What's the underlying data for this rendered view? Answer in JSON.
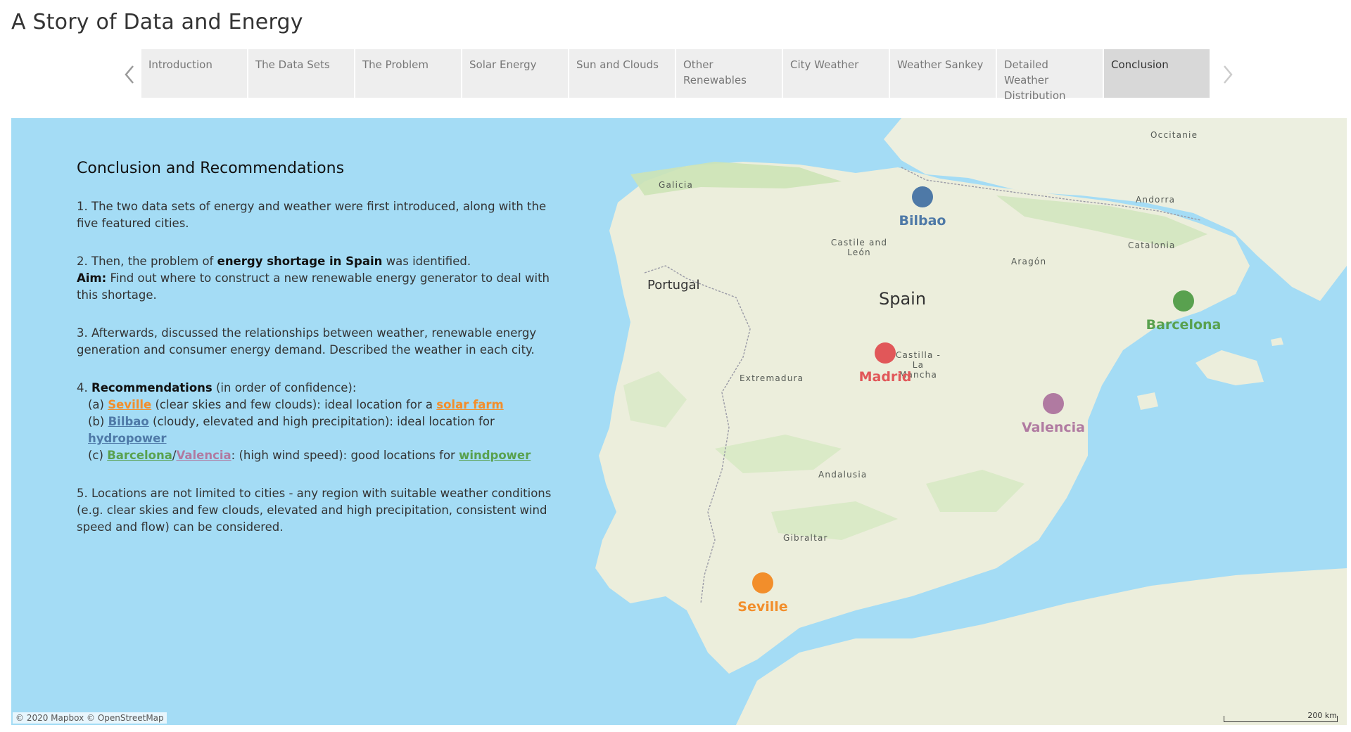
{
  "app": {
    "title": "A Story of Data and Energy"
  },
  "nav": {
    "tabs": [
      {
        "label": "Introduction"
      },
      {
        "label": "The Data Sets"
      },
      {
        "label": "The Problem"
      },
      {
        "label": "Solar Energy"
      },
      {
        "label": "Sun and Clouds"
      },
      {
        "label": "Other Renewables"
      },
      {
        "label": "City Weather"
      },
      {
        "label": "Weather Sankey"
      },
      {
        "label": "Detailed Weather Distribution"
      },
      {
        "label": "Conclusion",
        "active": true
      }
    ],
    "prev_icon": "chevron-left-icon",
    "next_icon": "chevron-right-icon"
  },
  "colors": {
    "seville": "#f28e2b",
    "bilbao": "#4e79a7",
    "barcelona": "#59a14f",
    "valencia": "#b07aa1",
    "madrid": "#e15759"
  },
  "conclusion": {
    "heading": "Conclusion and Recommendations",
    "p1": "1. The two data sets of energy and weather were first introduced, along with the five featured cities.",
    "p2_a": "2. Then, the problem of ",
    "p2_bold": "energy shortage in Spain",
    "p2_b": " was identified.",
    "aim_label": "Aim:",
    "aim_text": " Find out where to construct a new renewable energy generator to deal with this shortage.",
    "p3": "3. Afterwards, discussed the relationships between weather, renewable energy generation and consumer energy demand. Described the weather in each city.",
    "p4_a": "4. ",
    "p4_bold": "Recommendations",
    "p4_b": " (in order of confidence):",
    "rec_a_prefix": "(a)  ",
    "rec_a_city": "Seville",
    "rec_a_text": " (clear skies and few clouds): ideal location for a ",
    "rec_a_target": "solar farm",
    "rec_b_prefix": "(b)  ",
    "rec_b_city": "Bilbao",
    "rec_b_text": " (cloudy, elevated and high precipitation): ideal location for ",
    "rec_b_target": "hydropower",
    "rec_c_prefix": "(c)  ",
    "rec_c_city1": "Barcelona",
    "rec_c_sep": "/",
    "rec_c_city2": "Valencia",
    "rec_c_text": ": (high wind speed): good locations for ",
    "rec_c_target": "windpower",
    "p5": "5. Locations are not limited to cities - any region with suitable weather conditions (e.g. clear skies and few clouds, elevated and high precipitation, consistent wind speed and flow) can be considered."
  },
  "map": {
    "country_labels": {
      "spain": "Spain",
      "portugal": "Portugal"
    },
    "regions": {
      "occitanie": "Occitanie",
      "galicia": "Galicia",
      "andorra": "Andorra",
      "castile_leon": "Castile and León",
      "catalonia": "Catalonia",
      "aragon": "Aragón",
      "castilla_la_mancha": "Castilla - La Mancha",
      "extremadura": "Extremadura",
      "andalusia": "Andalusia",
      "gibraltar": "Gibraltar"
    },
    "cities": [
      {
        "key": "bilbao",
        "name": "Bilbao"
      },
      {
        "key": "barcelona",
        "name": "Barcelona"
      },
      {
        "key": "madrid",
        "name": "Madrid"
      },
      {
        "key": "valencia",
        "name": "Valencia"
      },
      {
        "key": "seville",
        "name": "Seville"
      }
    ],
    "attribution": "© 2020 Mapbox © OpenStreetMap",
    "scale_label": "200 km"
  }
}
